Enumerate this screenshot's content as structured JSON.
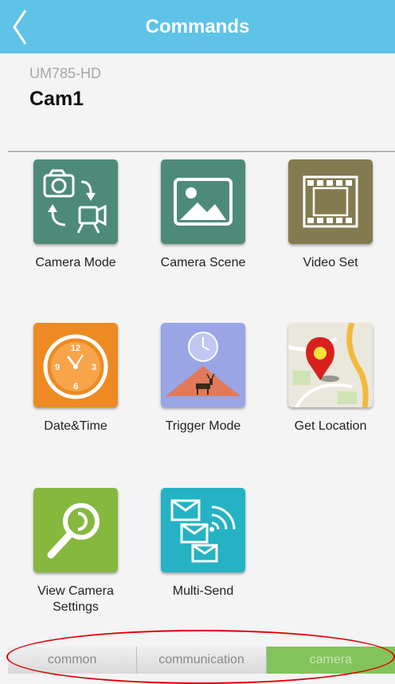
{
  "header": {
    "title": "Commands"
  },
  "device": {
    "model": "UM785-HD",
    "name": "Cam1"
  },
  "commands": [
    {
      "label": "Camera Mode",
      "color": "#4e8a79"
    },
    {
      "label": "Camera Scene",
      "color": "#4e8a79"
    },
    {
      "label": "Video Set",
      "color": "#837a50"
    },
    {
      "label": "Date&Time",
      "color": "#ee8a22"
    },
    {
      "label": "Trigger Mode",
      "color": "#9aa5e6"
    },
    {
      "label": "Get Location",
      "color": "#eae7dc"
    },
    {
      "label": "View Camera\nSettings",
      "color": "#86b83e"
    },
    {
      "label": "Multi-Send",
      "color": "#24b2c4"
    }
  ],
  "tabs": [
    {
      "label": "common"
    },
    {
      "label": "communication"
    },
    {
      "label": "camera",
      "active": true
    }
  ],
  "accent_color": "#5ec3e6"
}
